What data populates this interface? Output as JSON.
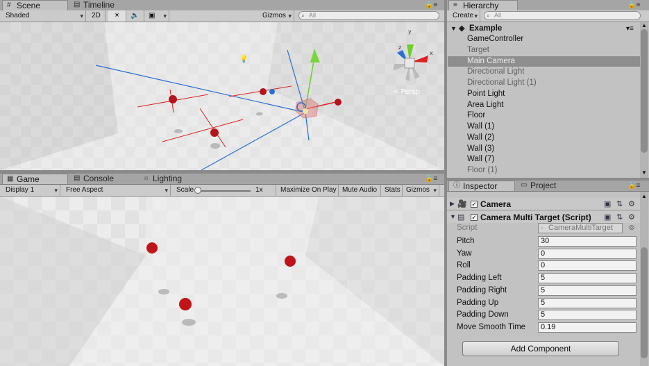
{
  "scene": {
    "tabs": [
      {
        "label": "Scene",
        "icon": "grid-icon"
      },
      {
        "label": "Timeline",
        "icon": "film-icon"
      }
    ],
    "toolbar": {
      "shading": "Shaded",
      "mode_2d": "2D",
      "gizmos": "Gizmos",
      "search_placeholder": "All"
    },
    "gizmo": {
      "x": "x",
      "y": "y",
      "z": "z",
      "persp": "< Persp"
    }
  },
  "game": {
    "tabs": [
      {
        "label": "Game",
        "icon": "game-icon"
      },
      {
        "label": "Console",
        "icon": "console-icon"
      },
      {
        "label": "Lighting",
        "icon": "lighting-icon"
      }
    ],
    "toolbar": {
      "display": "Display 1",
      "aspect": "Free Aspect",
      "scale_label": "Scale",
      "scale_value": "1x",
      "scale_fraction": 0.0,
      "maximize": "Maximize On Play",
      "mute": "Mute Audio",
      "stats": "Stats",
      "gizmos": "Gizmos"
    }
  },
  "hierarchy": {
    "tab": "Hierarchy",
    "create": "Create",
    "search_placeholder": "All",
    "scene_name": "Example",
    "items": [
      {
        "label": "GameController",
        "state": "normal"
      },
      {
        "label": "Target",
        "state": "dim"
      },
      {
        "label": "Main Camera",
        "state": "selected"
      },
      {
        "label": "Directional Light",
        "state": "dim"
      },
      {
        "label": "Directional Light (1)",
        "state": "dim"
      },
      {
        "label": "Point Light",
        "state": "normal"
      },
      {
        "label": "Area Light",
        "state": "normal"
      },
      {
        "label": "Floor",
        "state": "normal"
      },
      {
        "label": "Wall (1)",
        "state": "normal"
      },
      {
        "label": "Wall (2)",
        "state": "normal"
      },
      {
        "label": "Wall (3)",
        "state": "normal"
      },
      {
        "label": "Wall (7)",
        "state": "normal"
      },
      {
        "label": "Floor (1)",
        "state": "dim"
      }
    ]
  },
  "inspector": {
    "tabs": [
      {
        "label": "Inspector",
        "icon": "info-icon"
      },
      {
        "label": "Project",
        "icon": "folder-icon"
      }
    ],
    "components": [
      {
        "name": "Camera",
        "icon": "camera-icon"
      },
      {
        "name": "Camera Multi Target (Script)",
        "icon": "script-icon"
      }
    ],
    "script_label": "Script",
    "script_value": "CameraMultiTarget",
    "fields": [
      {
        "label": "Pitch",
        "value": "30"
      },
      {
        "label": "Yaw",
        "value": "0"
      },
      {
        "label": "Roll",
        "value": "0"
      },
      {
        "label": "Padding Left",
        "value": "5"
      },
      {
        "label": "Padding Right",
        "value": "5"
      },
      {
        "label": "Padding Up",
        "value": "5"
      },
      {
        "label": "Padding Down",
        "value": "5"
      },
      {
        "label": "Move Smooth Time",
        "value": "0.19"
      }
    ],
    "add_component": "Add Component"
  },
  "colors": {
    "selection": "#8e8e8e",
    "sphere": "#c0141a",
    "panel": "#c2c2c2"
  }
}
